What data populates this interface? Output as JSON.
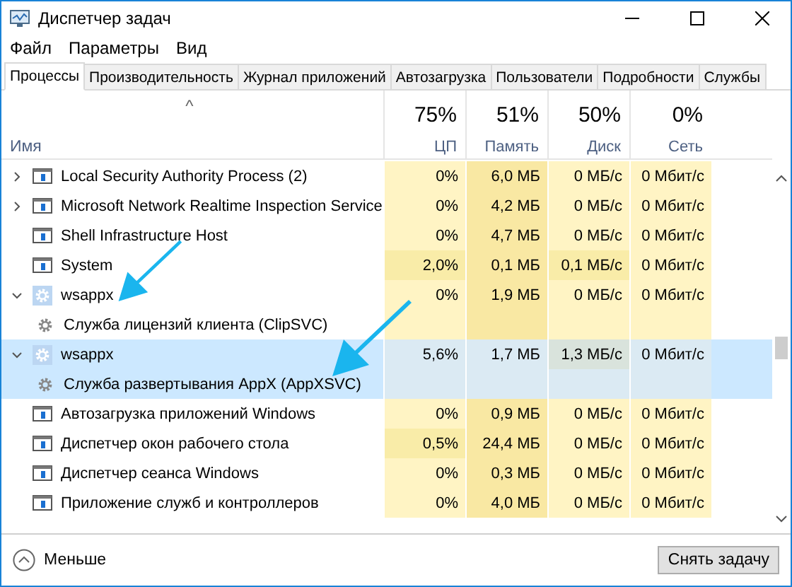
{
  "window": {
    "title": "Диспетчер задач"
  },
  "menu": [
    "Файл",
    "Параметры",
    "Вид"
  ],
  "tabs": [
    {
      "label": "Процессы",
      "selected": true
    },
    {
      "label": "Производительность",
      "selected": false
    },
    {
      "label": "Журнал приложений",
      "selected": false
    },
    {
      "label": "Автозагрузка",
      "selected": false
    },
    {
      "label": "Пользователи",
      "selected": false
    },
    {
      "label": "Подробности",
      "selected": false
    },
    {
      "label": "Службы",
      "selected": false
    }
  ],
  "table": {
    "name_column": "Имя",
    "sort_indicator": "^",
    "columns": [
      {
        "total": "75%",
        "label": "ЦП"
      },
      {
        "total": "51%",
        "label": "Память"
      },
      {
        "total": "50%",
        "label": "Диск"
      },
      {
        "total": "0%",
        "label": "Сеть"
      }
    ],
    "rows": [
      {
        "kind": "process",
        "name": "Local Security Authority Process (2)",
        "expanded": false,
        "selected": false,
        "cells": [
          {
            "value": "0%",
            "hot": false
          },
          {
            "value": "6,0 МБ"
          },
          {
            "value": "0 МБ/с",
            "hot": false
          },
          {
            "value": "0 Мбит/с",
            "hot": false
          }
        ]
      },
      {
        "kind": "process",
        "name": "Microsoft Network Realtime Inspection Service",
        "expanded": false,
        "selected": false,
        "cells": [
          {
            "value": "0%",
            "hot": false
          },
          {
            "value": "4,2 МБ"
          },
          {
            "value": "0 МБ/с",
            "hot": false
          },
          {
            "value": "0 Мбит/с",
            "hot": false
          }
        ]
      },
      {
        "kind": "process",
        "name": "Shell Infrastructure Host",
        "selected": false,
        "cells": [
          {
            "value": "0%",
            "hot": false
          },
          {
            "value": "4,7 МБ"
          },
          {
            "value": "0 МБ/с",
            "hot": false
          },
          {
            "value": "0 Мбит/с",
            "hot": false
          }
        ]
      },
      {
        "kind": "process",
        "name": "System",
        "selected": false,
        "cells": [
          {
            "value": "2,0%",
            "hot": true
          },
          {
            "value": "0,1 МБ"
          },
          {
            "value": "0,1 МБ/с",
            "hot": true
          },
          {
            "value": "0 Мбит/с",
            "hot": false
          }
        ]
      },
      {
        "kind": "group",
        "name": "wsappx",
        "expanded": true,
        "selected": false,
        "cells": [
          {
            "value": "0%",
            "hot": false
          },
          {
            "value": "1,9 МБ"
          },
          {
            "value": "0 МБ/с",
            "hot": false
          },
          {
            "value": "0 Мбит/с",
            "hot": false
          }
        ],
        "children": [
          {
            "kind": "service",
            "name": "Служба лицензий клиента (ClipSVC)"
          }
        ]
      },
      {
        "kind": "group",
        "name": "wsappx",
        "expanded": true,
        "selected": true,
        "cells": [
          {
            "value": "5,6%",
            "hot": false
          },
          {
            "value": "1,7 МБ"
          },
          {
            "value": "1,3 МБ/с",
            "hot": true
          },
          {
            "value": "0 Мбит/с",
            "hot": false
          }
        ],
        "children": [
          {
            "kind": "service",
            "name": "Служба развертывания AppX (AppXSVC)"
          }
        ]
      },
      {
        "kind": "process",
        "name": "Автозагрузка приложений Windows",
        "selected": false,
        "cells": [
          {
            "value": "0%",
            "hot": false
          },
          {
            "value": "0,9 МБ"
          },
          {
            "value": "0 МБ/с",
            "hot": false
          },
          {
            "value": "0 Мбит/с",
            "hot": false
          }
        ]
      },
      {
        "kind": "process",
        "name": "Диспетчер окон рабочего стола",
        "selected": false,
        "cells": [
          {
            "value": "0,5%",
            "hot": true
          },
          {
            "value": "24,4 МБ"
          },
          {
            "value": "0 МБ/с",
            "hot": false
          },
          {
            "value": "0 Мбит/с",
            "hot": false
          }
        ]
      },
      {
        "kind": "process",
        "name": "Диспетчер сеанса  Windows",
        "selected": false,
        "cells": [
          {
            "value": "0%",
            "hot": false
          },
          {
            "value": "0,3 МБ"
          },
          {
            "value": "0 МБ/с",
            "hot": false
          },
          {
            "value": "0 Мбит/с",
            "hot": false
          }
        ]
      },
      {
        "kind": "process",
        "name": "Приложение служб и контроллеров",
        "selected": false,
        "cells": [
          {
            "value": "0%",
            "hot": false
          },
          {
            "value": "4,0 МБ"
          },
          {
            "value": "0 МБ/с",
            "hot": false
          },
          {
            "value": "0 Мбит/с",
            "hot": false
          }
        ]
      }
    ]
  },
  "footer": {
    "toggle": "Меньше",
    "end_task": "Снять задачу"
  }
}
